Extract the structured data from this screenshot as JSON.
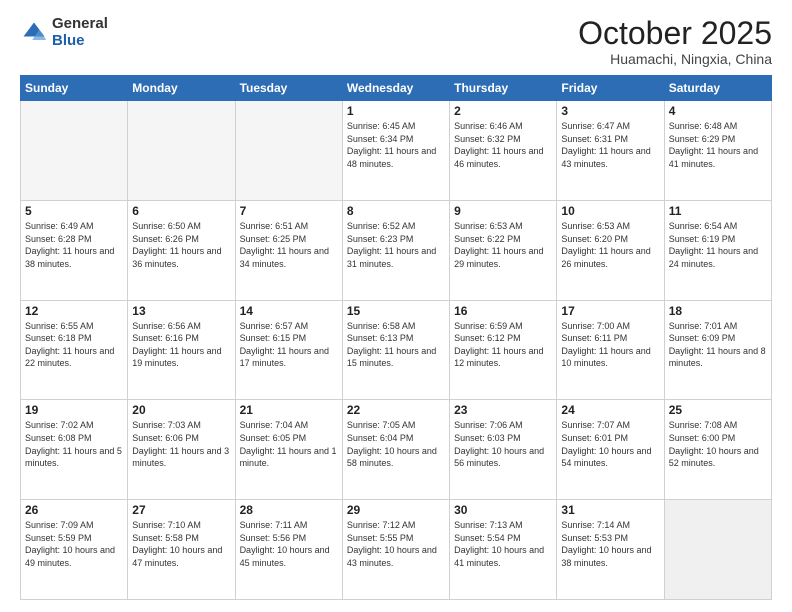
{
  "header": {
    "logo_general": "General",
    "logo_blue": "Blue",
    "month_title": "October 2025",
    "location": "Huamachi, Ningxia, China"
  },
  "weekdays": [
    "Sunday",
    "Monday",
    "Tuesday",
    "Wednesday",
    "Thursday",
    "Friday",
    "Saturday"
  ],
  "weeks": [
    [
      {
        "day": "",
        "empty": true
      },
      {
        "day": "",
        "empty": true
      },
      {
        "day": "",
        "empty": true
      },
      {
        "day": "1",
        "info": "Sunrise: 6:45 AM\nSunset: 6:34 PM\nDaylight: 11 hours\nand 48 minutes."
      },
      {
        "day": "2",
        "info": "Sunrise: 6:46 AM\nSunset: 6:32 PM\nDaylight: 11 hours\nand 46 minutes."
      },
      {
        "day": "3",
        "info": "Sunrise: 6:47 AM\nSunset: 6:31 PM\nDaylight: 11 hours\nand 43 minutes."
      },
      {
        "day": "4",
        "info": "Sunrise: 6:48 AM\nSunset: 6:29 PM\nDaylight: 11 hours\nand 41 minutes."
      }
    ],
    [
      {
        "day": "5",
        "info": "Sunrise: 6:49 AM\nSunset: 6:28 PM\nDaylight: 11 hours\nand 38 minutes."
      },
      {
        "day": "6",
        "info": "Sunrise: 6:50 AM\nSunset: 6:26 PM\nDaylight: 11 hours\nand 36 minutes."
      },
      {
        "day": "7",
        "info": "Sunrise: 6:51 AM\nSunset: 6:25 PM\nDaylight: 11 hours\nand 34 minutes."
      },
      {
        "day": "8",
        "info": "Sunrise: 6:52 AM\nSunset: 6:23 PM\nDaylight: 11 hours\nand 31 minutes."
      },
      {
        "day": "9",
        "info": "Sunrise: 6:53 AM\nSunset: 6:22 PM\nDaylight: 11 hours\nand 29 minutes."
      },
      {
        "day": "10",
        "info": "Sunrise: 6:53 AM\nSunset: 6:20 PM\nDaylight: 11 hours\nand 26 minutes."
      },
      {
        "day": "11",
        "info": "Sunrise: 6:54 AM\nSunset: 6:19 PM\nDaylight: 11 hours\nand 24 minutes."
      }
    ],
    [
      {
        "day": "12",
        "info": "Sunrise: 6:55 AM\nSunset: 6:18 PM\nDaylight: 11 hours\nand 22 minutes."
      },
      {
        "day": "13",
        "info": "Sunrise: 6:56 AM\nSunset: 6:16 PM\nDaylight: 11 hours\nand 19 minutes."
      },
      {
        "day": "14",
        "info": "Sunrise: 6:57 AM\nSunset: 6:15 PM\nDaylight: 11 hours\nand 17 minutes."
      },
      {
        "day": "15",
        "info": "Sunrise: 6:58 AM\nSunset: 6:13 PM\nDaylight: 11 hours\nand 15 minutes."
      },
      {
        "day": "16",
        "info": "Sunrise: 6:59 AM\nSunset: 6:12 PM\nDaylight: 11 hours\nand 12 minutes."
      },
      {
        "day": "17",
        "info": "Sunrise: 7:00 AM\nSunset: 6:11 PM\nDaylight: 11 hours\nand 10 minutes."
      },
      {
        "day": "18",
        "info": "Sunrise: 7:01 AM\nSunset: 6:09 PM\nDaylight: 11 hours\nand 8 minutes."
      }
    ],
    [
      {
        "day": "19",
        "info": "Sunrise: 7:02 AM\nSunset: 6:08 PM\nDaylight: 11 hours\nand 5 minutes."
      },
      {
        "day": "20",
        "info": "Sunrise: 7:03 AM\nSunset: 6:06 PM\nDaylight: 11 hours\nand 3 minutes."
      },
      {
        "day": "21",
        "info": "Sunrise: 7:04 AM\nSunset: 6:05 PM\nDaylight: 11 hours\nand 1 minute."
      },
      {
        "day": "22",
        "info": "Sunrise: 7:05 AM\nSunset: 6:04 PM\nDaylight: 10 hours\nand 58 minutes."
      },
      {
        "day": "23",
        "info": "Sunrise: 7:06 AM\nSunset: 6:03 PM\nDaylight: 10 hours\nand 56 minutes."
      },
      {
        "day": "24",
        "info": "Sunrise: 7:07 AM\nSunset: 6:01 PM\nDaylight: 10 hours\nand 54 minutes."
      },
      {
        "day": "25",
        "info": "Sunrise: 7:08 AM\nSunset: 6:00 PM\nDaylight: 10 hours\nand 52 minutes."
      }
    ],
    [
      {
        "day": "26",
        "info": "Sunrise: 7:09 AM\nSunset: 5:59 PM\nDaylight: 10 hours\nand 49 minutes."
      },
      {
        "day": "27",
        "info": "Sunrise: 7:10 AM\nSunset: 5:58 PM\nDaylight: 10 hours\nand 47 minutes."
      },
      {
        "day": "28",
        "info": "Sunrise: 7:11 AM\nSunset: 5:56 PM\nDaylight: 10 hours\nand 45 minutes."
      },
      {
        "day": "29",
        "info": "Sunrise: 7:12 AM\nSunset: 5:55 PM\nDaylight: 10 hours\nand 43 minutes."
      },
      {
        "day": "30",
        "info": "Sunrise: 7:13 AM\nSunset: 5:54 PM\nDaylight: 10 hours\nand 41 minutes."
      },
      {
        "day": "31",
        "info": "Sunrise: 7:14 AM\nSunset: 5:53 PM\nDaylight: 10 hours\nand 38 minutes."
      },
      {
        "day": "",
        "empty": true,
        "shaded": true
      }
    ]
  ]
}
